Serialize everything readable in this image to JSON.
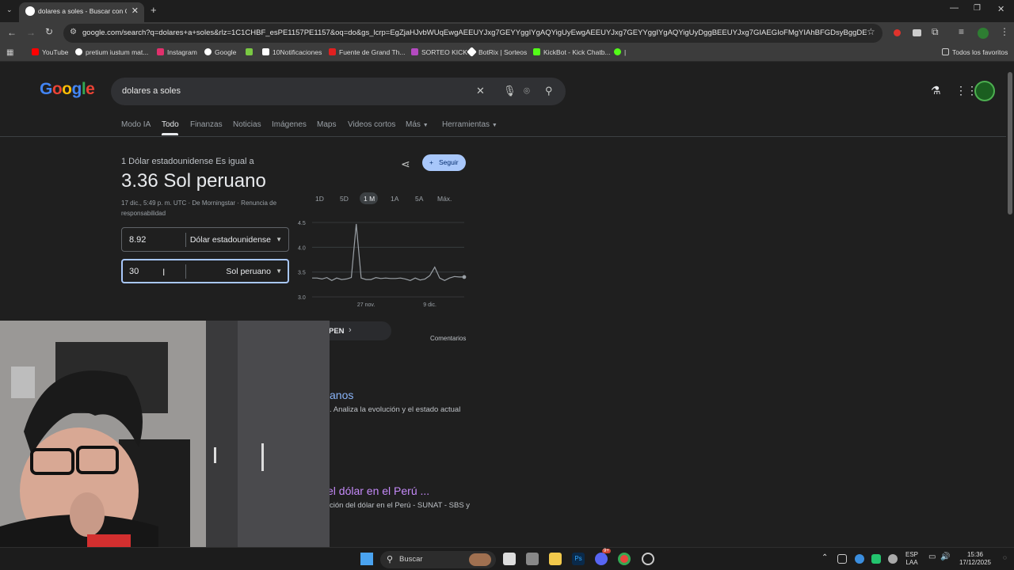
{
  "browser": {
    "tab_title": "dolares a soles - Buscar con Goo",
    "tab_close": "✕",
    "new_tab": "+",
    "url": "google.com/search?q=dolares+a+soles&rlz=1C1CHBF_esPE1157PE1157&oq=do&gs_lcrp=EgZjaHJvbWUqEwgAEEUYJxg7GEYYggIYgAQYigUyEwgAEEUYJxg7GEYYggIYgAQYigUyDggBEEUYJxg7GIAEGIoFMgYIAhBFGDsyBggDEEUYQDIGCAQ...",
    "bookmarks": [
      {
        "label": "YouTube",
        "color": "#ff0000"
      },
      {
        "label": "pretium iustum mat...",
        "color": "#ffffff"
      },
      {
        "label": "Instagram",
        "color": "#e1306c"
      },
      {
        "label": "Google",
        "color": "#ffffff"
      },
      {
        "label": "",
        "color": "#7ac943"
      },
      {
        "label": "10Notificaciones",
        "color": "#ffffff"
      },
      {
        "label": "Fuente de Grand Th...",
        "color": "#e02020"
      },
      {
        "label": "SORTEO KICK",
        "color": "#b44ac0"
      },
      {
        "label": "BotRix | Sorteos",
        "color": "#ffffff"
      },
      {
        "label": "KickBot - Kick Chatb...",
        "color": "#53fc18"
      },
      {
        "label": "|",
        "color": "#53fc18"
      }
    ],
    "all_bookmarks": "Todos los favoritos"
  },
  "search": {
    "logo": "Google",
    "query": "dolares a soles",
    "tabs": [
      "Modo IA",
      "Todo",
      "Finanzas",
      "Noticias",
      "Imágenes",
      "Maps",
      "Videos cortos",
      "Más",
      "Herramientas"
    ],
    "active_tab": "Todo"
  },
  "converter": {
    "equals_label": "1 Dólar estadounidense Es igual a",
    "rate": "3.36 Sol peruano",
    "meta": "17 dic., 5:49 p. m. UTC · De Morningstar · Renuncia de responsabilidad",
    "follow_label": "Seguir",
    "from_value": "8.92",
    "from_currency": "Dólar estadounidense",
    "to_value": "30",
    "to_currency": "Sol peruano",
    "ranges": [
      "1D",
      "5D",
      "1 M",
      "1A",
      "5A",
      "Máx."
    ],
    "active_range": "1 M",
    "comments": "Comentarios",
    "pill_text": "PEN"
  },
  "chart_data": {
    "type": "line",
    "title": "",
    "x_ticks": [
      "27 nov.",
      "9 dic."
    ],
    "y_ticks": [
      "4.5",
      "4.0",
      "3.5",
      "3.0"
    ],
    "ylim": [
      3.0,
      4.5
    ],
    "series": [
      {
        "values": [
          3.38,
          3.38,
          3.36,
          3.39,
          3.33,
          3.38,
          3.35,
          3.36,
          3.39,
          4.47,
          3.38,
          3.35,
          3.35,
          3.39,
          3.37,
          3.38,
          3.37,
          3.37,
          3.38,
          3.36,
          3.33,
          3.38,
          3.34,
          3.36,
          3.43,
          3.6,
          3.38,
          3.33,
          3.38,
          3.41,
          3.4,
          3.4
        ]
      }
    ],
    "line_color": "#9aa0a6"
  },
  "results": [
    {
      "title": "anos",
      "snippet": ". Analiza la evolución y el estado actual"
    },
    {
      "title": "el dólar en el Perú ...",
      "snippet": "ción del dólar en el Perú - SUNAT - SBS y"
    }
  ],
  "taskbar": {
    "search_label": "Buscar",
    "lang_line1": "ESP",
    "lang_line2": "LAA",
    "time": "15:36",
    "date": "17/12/2025",
    "discord_badge": "9+"
  }
}
